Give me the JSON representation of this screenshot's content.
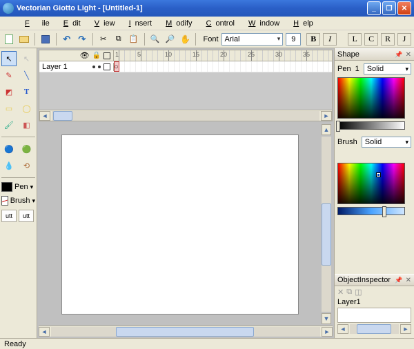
{
  "window": {
    "title": "Vectorian Giotto Light - [Untitled-1]"
  },
  "menu": {
    "file": "File",
    "edit": "Edit",
    "view": "View",
    "insert": "Insert",
    "modify": "Modify",
    "control": "Control",
    "window": "Window",
    "help": "Help"
  },
  "toolbar": {
    "font_label": "Font",
    "font_name": "Arial",
    "font_size": "9",
    "style_buttons": {
      "b": "B",
      "i": "I",
      "l": "L",
      "c": "C",
      "r": "R",
      "j": "J"
    }
  },
  "timeline": {
    "layer_name": "Layer 1",
    "ruler": [
      "1",
      "5",
      "10",
      "15",
      "20",
      "25",
      "30",
      "35"
    ]
  },
  "color_controls": {
    "pen_label": "Pen",
    "brush_label": "Brush",
    "utt": "utt"
  },
  "shape_panel": {
    "title": "Shape",
    "pen_label": "Pen",
    "pen_width": "1",
    "pen_style": "Solid",
    "brush_label": "Brush",
    "brush_style": "Solid"
  },
  "inspector": {
    "title": "ObjectInspector",
    "root": "Layer1"
  },
  "status": {
    "text": "Ready"
  }
}
